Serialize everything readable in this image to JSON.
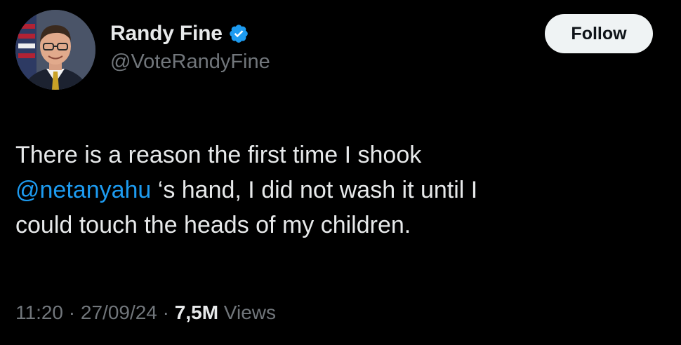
{
  "author": {
    "display_name": "Randy Fine",
    "handle": "@VoteRandyFine",
    "verified_icon": "verified-badge-icon",
    "verified_color": "#1d9bf0"
  },
  "follow_button": {
    "label": "Follow"
  },
  "tweet": {
    "line1": "There is a reason the first time I shook",
    "mention": "@netanyahu",
    "line2_rest": " ‘s hand, I did not wash it until I",
    "line3": "could touch the heads of my children."
  },
  "meta": {
    "time": "11:20",
    "separator": " · ",
    "date": "27/09/24",
    "views_count": "7,5M",
    "views_label": " Views"
  },
  "colors": {
    "background": "#000000",
    "text_primary": "#e7e9ea",
    "text_secondary": "#71767b",
    "link": "#1d9bf0",
    "button_bg": "#eff3f4"
  }
}
